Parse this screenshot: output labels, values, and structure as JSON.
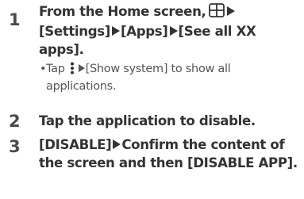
{
  "steps": [
    {
      "number": "1",
      "text_a": "From the Home screen,",
      "icon": "apps-grid-icon",
      "text_b": "[Settings]",
      "text_c": "[Apps]",
      "text_d": "[See all XX apps].",
      "note": {
        "bullet": "•",
        "prefix": "Tap",
        "icon": "more-vertical-icon",
        "suffix": "[Show system] to show all applications."
      }
    },
    {
      "number": "2",
      "text": "Tap the application to disable."
    },
    {
      "number": "3",
      "text_a": "[DISABLE]",
      "text_b": "Confirm the content of the screen and then [DISABLE APP]."
    }
  ],
  "colors": {
    "text": "#333333",
    "note_text": "#555555"
  }
}
